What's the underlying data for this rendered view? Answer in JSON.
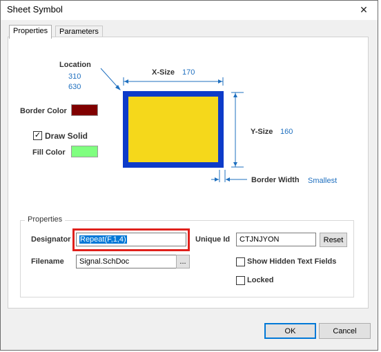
{
  "window": {
    "title": "Sheet Symbol"
  },
  "tabs": [
    {
      "label": "Properties",
      "active": true
    },
    {
      "label": "Parameters",
      "active": false
    }
  ],
  "location": {
    "label": "Location",
    "x": "310",
    "y": "630"
  },
  "size": {
    "x_label": "X-Size",
    "x_value": "170",
    "y_label": "Y-Size",
    "y_value": "160"
  },
  "border_color": {
    "label": "Border Color",
    "color": "#800000"
  },
  "draw_solid": {
    "label": "Draw Solid",
    "checked": true
  },
  "fill_color": {
    "label": "Fill Color",
    "color": "#80ff80"
  },
  "border_width": {
    "label": "Border Width",
    "value": "Smallest"
  },
  "preview": {
    "border": "#0d3bc9",
    "fill": "#f5d81b"
  },
  "properties": {
    "title": "Properties",
    "designator_label": "Designator",
    "designator_value": "Repeat(F,1,4)",
    "filename_label": "Filename",
    "filename_value": "Signal.SchDoc",
    "browse_label": "...",
    "unique_id_label": "Unique Id",
    "unique_id_value": "CTJNJYON",
    "reset_label": "Reset",
    "show_hidden_label": "Show Hidden Text Fields",
    "show_hidden_checked": false,
    "locked_label": "Locked",
    "locked_checked": false
  },
  "buttons": {
    "ok": "OK",
    "cancel": "Cancel"
  }
}
